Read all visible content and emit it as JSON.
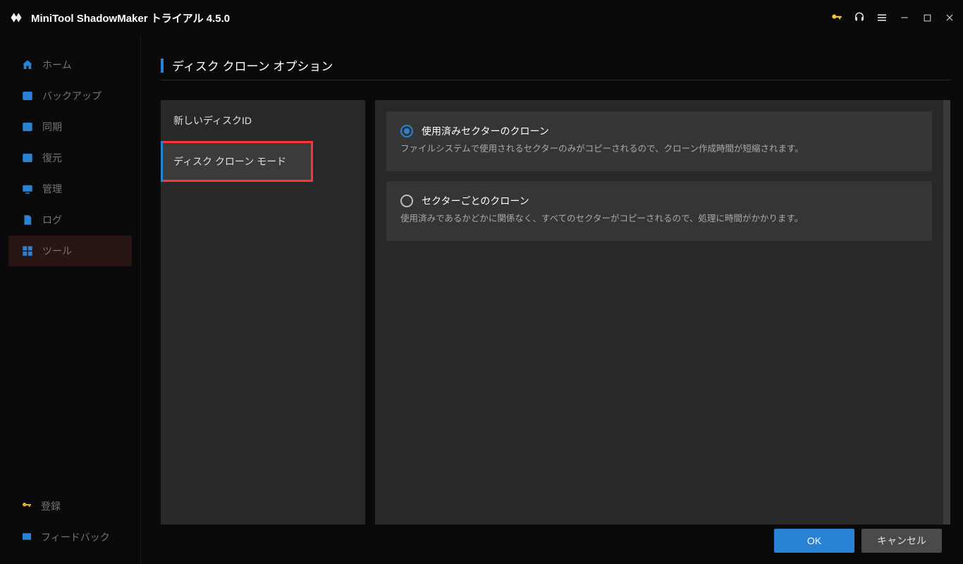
{
  "titlebar": {
    "title": "MiniTool ShadowMaker トライアル 4.5.0"
  },
  "sidebar": {
    "items": [
      {
        "label": "ホーム"
      },
      {
        "label": "バックアップ"
      },
      {
        "label": "同期"
      },
      {
        "label": "復元"
      },
      {
        "label": "管理"
      },
      {
        "label": "ログ"
      },
      {
        "label": "ツール"
      }
    ],
    "bottom": {
      "register": "登録",
      "feedback": "フィードバック"
    }
  },
  "page": {
    "title": "ディスク クローン オプション"
  },
  "options": {
    "categories": [
      {
        "label": "新しいディスクID"
      },
      {
        "label": "ディスク クローン モード"
      }
    ],
    "modes": [
      {
        "title": "使用済みセクターのクローン",
        "description": "ファイルシステムで使用されるセクターのみがコピーされるので、クローン作成時間が短縮されます。",
        "selected": true
      },
      {
        "title": "セクターごとのクローン",
        "description": "使用済みであるかどかに関係なく、すべてのセクターがコピーされるので、処理に時間がかかります。",
        "selected": false
      }
    ]
  },
  "footer": {
    "ok": "OK",
    "cancel": "キャンセル"
  }
}
